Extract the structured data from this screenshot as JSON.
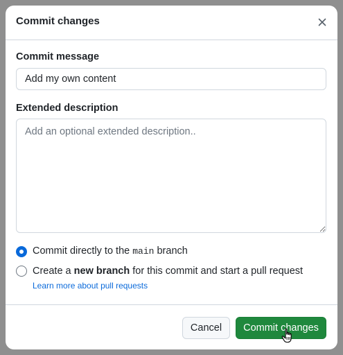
{
  "dialog": {
    "title": "Commit changes",
    "close_icon": "close-icon"
  },
  "commit_message": {
    "label": "Commit message",
    "value": "Add my own content"
  },
  "extended_description": {
    "label": "Extended description",
    "placeholder": "Add an optional extended description.."
  },
  "branch_options": {
    "direct": {
      "prefix": "Commit directly to the ",
      "branch": "main",
      "suffix": " branch",
      "checked": true
    },
    "new_branch": {
      "prefix": "Create a ",
      "emphasis": "new branch",
      "suffix": " for this commit and start a pull request",
      "checked": false
    },
    "learn_more": "Learn more about pull requests"
  },
  "footer": {
    "cancel_label": "Cancel",
    "commit_label": "Commit changes"
  },
  "colors": {
    "primary_button": "#1f883d",
    "accent": "#0969da",
    "link": "#0969da"
  }
}
